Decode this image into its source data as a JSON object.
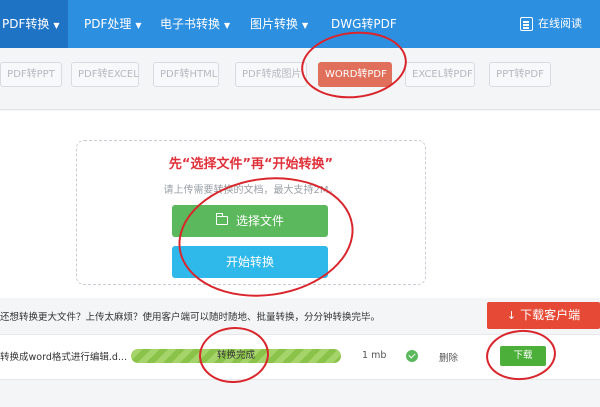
{
  "nav": {
    "items": [
      {
        "label": "PDF转换",
        "caret": "▼",
        "active": true
      },
      {
        "label": "PDF处理",
        "caret": "▼",
        "active": false
      },
      {
        "label": "电子书转换",
        "caret": "▼",
        "active": false
      },
      {
        "label": "图片转换",
        "caret": "▼",
        "active": false
      },
      {
        "label": "DWG转PDF",
        "caret": "",
        "active": false
      }
    ],
    "online_read": "在线阅读"
  },
  "subtabs": [
    "PDF转PPT",
    "PDF转EXCEL",
    "PDF转HTML",
    "PDF转成图片",
    "WORD转PDF",
    "EXCEL转PDF",
    "PPT转PDF"
  ],
  "subtabs_active": "WORD转PDF",
  "upload": {
    "title": "先“选择文件”再“开始转换”",
    "hint": "请上传需要转换的文档，最大支持2M。",
    "select_button": "选择文件",
    "start_button": "开始转换"
  },
  "info": {
    "text": "还想转换更大文件？上传太麻烦？使用客户端可以随时随地、批量转换，分分钟转换完毕。",
    "client_button": "下载客户端"
  },
  "file": {
    "name": "转换成word格式进行编辑.d...",
    "status": "转换完成",
    "progress": 1.0,
    "size": "1 mb",
    "delete": "删除",
    "download": "下载"
  },
  "colors": {
    "nav_bg": "#2d8fe0",
    "nav_active": "#1f73c4",
    "tab_active": "#e0705c",
    "select_btn": "#5cb85c",
    "start_btn": "#2fb8ea",
    "client_btn": "#e64a36",
    "download_btn": "#4caf3a",
    "annotation": "#d9262c"
  }
}
